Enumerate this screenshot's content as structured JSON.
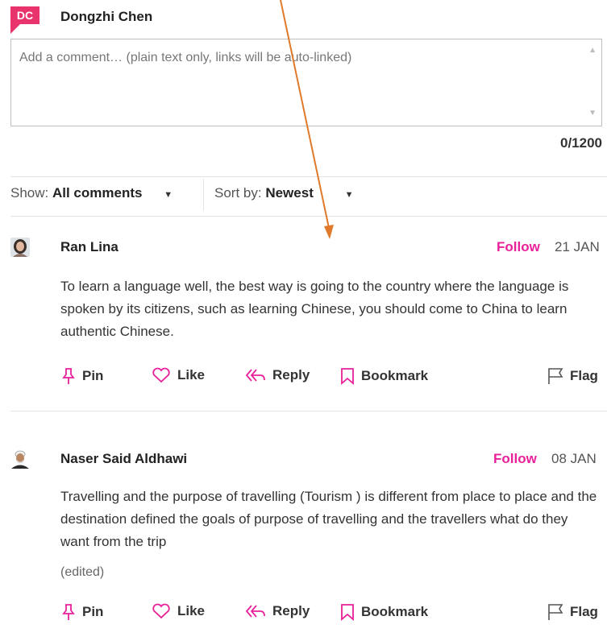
{
  "current_user": {
    "initials": "DC",
    "name": "Dongzhi Chen"
  },
  "comment_input": {
    "placeholder": "Add a comment… (plain text only, links will be auto-linked)",
    "value": "",
    "counter": "0/1200"
  },
  "filters": {
    "show_label": "Show:",
    "show_value": "All comments",
    "sort_label": "Sort by:",
    "sort_value": "Newest"
  },
  "colors": {
    "accent": "#e8219a",
    "badge": "#e8336d",
    "annotation_arrow": "#e07a2a"
  },
  "comments": [
    {
      "author": "Ran Lina",
      "follow": "Follow",
      "date": "21 JAN",
      "text": "To learn a language well, the best way is going to the country where the language is spoken by its citizens, such as learning Chinese, you should come to China to learn authentic Chinese.",
      "edited": "",
      "actions": {
        "pin": "Pin",
        "like": "Like",
        "reply": "Reply",
        "bookmark": "Bookmark",
        "flag": "Flag"
      }
    },
    {
      "author": "Naser Said Aldhawi",
      "follow": "Follow",
      "date": "08 JAN",
      "text": "Travelling and the purpose of travelling (Tourism ) is different from place to place and the destination defined the goals of purpose of travelling and the travellers what do they want from the trip",
      "edited": "(edited)",
      "actions": {
        "pin": "Pin",
        "like": "Like",
        "reply": "Reply",
        "bookmark": "Bookmark",
        "flag": "Flag"
      }
    }
  ]
}
